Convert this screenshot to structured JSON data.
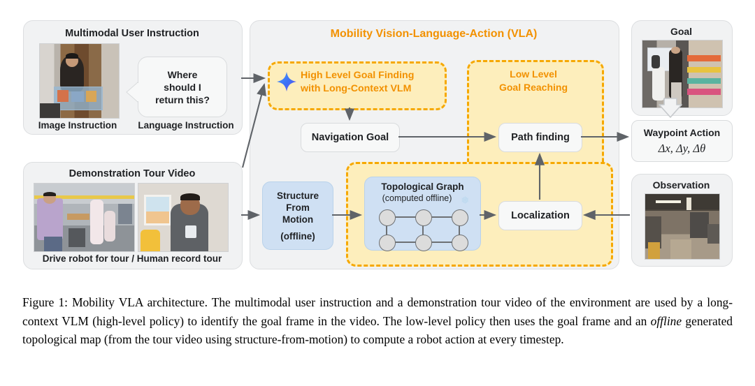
{
  "figure": {
    "label": "Figure 1:",
    "caption_plain": "Figure 1: Mobility VLA architecture. The multimodal user instruction and a demonstration tour video of the environment are used by a long-context VLM (high-level policy) to identify the goal frame in the video. The low-level policy then uses the goal frame and an offline generated topological map (from the tour video using structure-from-motion) to compute a robot action at every timestep.",
    "caption_part1": "Figure 1: Mobility VLA architecture. The multimodal user instruction and a demonstration tour video of the environment are used by a long-context VLM (high-level policy) to identify the goal frame in the video. The low-level policy then uses the goal frame and an ",
    "caption_italic": "offline",
    "caption_part2": " generated topological map (from the tour video using structure-from-motion) to compute a robot action at every timestep."
  },
  "instruction_panel": {
    "title": "Multimodal User Instruction",
    "image_caption": "Image Instruction",
    "language_caption": "Language Instruction",
    "speech_bubble": "Where\nshould I\nreturn this?",
    "speech_line1": "Where",
    "speech_line2": "should I",
    "speech_line3": "return this?",
    "image_alt": "person-holding-bin-photo"
  },
  "tour_panel": {
    "title": "Demonstration Tour Video",
    "caption": "Drive robot for tour  /  Human record tour",
    "left_image_alt": "person-driving-robot-office-photo",
    "right_image_alt": "person-recording-phone-photo"
  },
  "vla_panel": {
    "title": "Mobility Vision-Language-Action (VLA)",
    "high_level": {
      "line1": "High Level Goal Finding",
      "line2": "with Long-Context VLM",
      "icon": "gemini-sparkle-icon"
    },
    "low_level": {
      "line1": "Low Level",
      "line2": "Goal Reaching"
    },
    "navigation_goal": "Navigation Goal",
    "path_finding": "Path finding",
    "localization": "Localization",
    "structure_from_motion": {
      "line1": "Structure",
      "line2": "From",
      "line3": "Motion",
      "line4": "(offline)"
    },
    "topological_graph": {
      "title": "Topological Graph",
      "subtitle": "(computed offline)",
      "frozen_icon": "snowflake-icon",
      "nodes": 6,
      "edges": 7
    }
  },
  "right_column": {
    "goal": {
      "title": "Goal",
      "image_alt": "robot-and-person-in-storage-room-photo"
    },
    "waypoint_action": {
      "title": "Waypoint Action",
      "formula": "Δx, Δy, Δθ"
    },
    "observation": {
      "title": "Observation",
      "image_alt": "robot-camera-view-workshop-photo"
    }
  },
  "colors": {
    "accent_orange": "#f29100",
    "dash_orange": "#f6a800",
    "dash_fill": "#fdeebc",
    "blue_box": "#cfe0f3",
    "panel_gray": "#f1f2f3",
    "white_box": "#f7f8f8",
    "arrow_gray": "#5f6368",
    "node_gray": "#dcdcdc"
  }
}
